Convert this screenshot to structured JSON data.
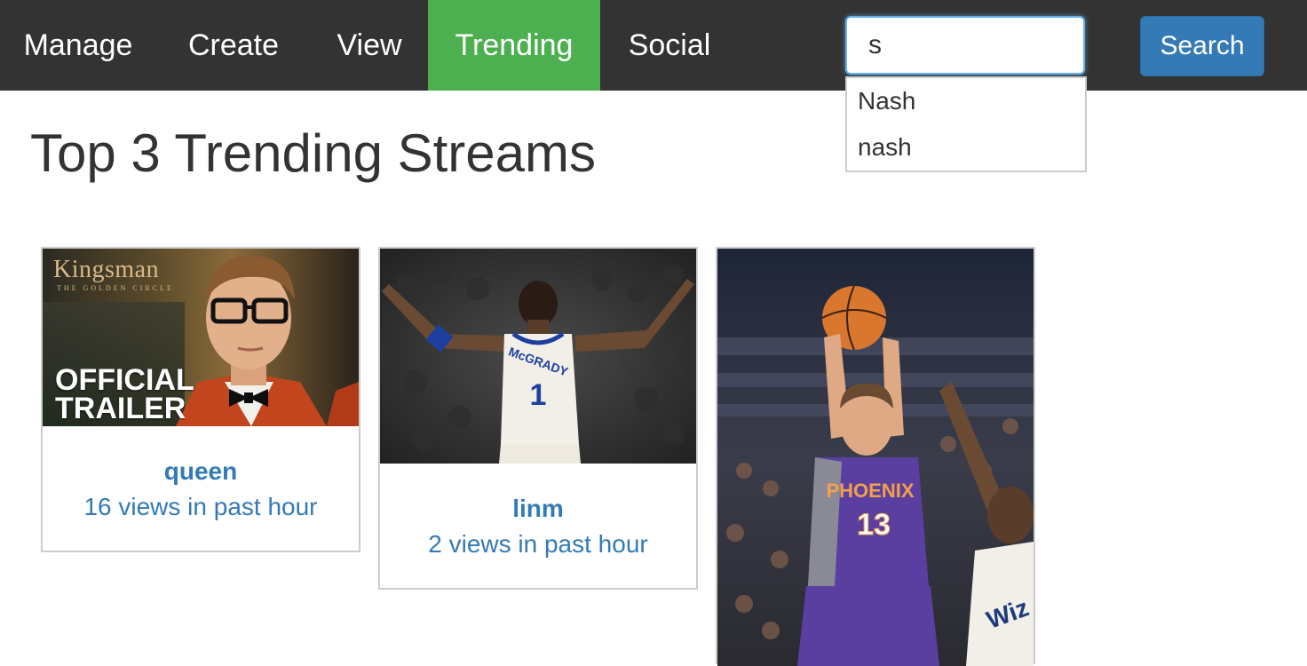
{
  "nav": {
    "items": [
      {
        "label": "Manage",
        "active": false
      },
      {
        "label": "Create",
        "active": false
      },
      {
        "label": "View",
        "active": false
      },
      {
        "label": "Trending",
        "active": true
      },
      {
        "label": "Social",
        "active": false
      }
    ],
    "active_color": "#4caf50",
    "background_color": "#333333"
  },
  "search": {
    "value": "s",
    "button_label": "Search",
    "button_color": "#337ab7",
    "suggestions": [
      "Nash",
      "nash"
    ]
  },
  "page": {
    "title": "Top 3 Trending Streams"
  },
  "streams": [
    {
      "name": "queen",
      "views": "16 views in past hour",
      "thumbnail": {
        "logo": "Kingsman",
        "logo_sub": "THE GOLDEN CIRCLE",
        "overlay_line1": "OFFICIAL",
        "overlay_line2": "TRAILER"
      }
    },
    {
      "name": "linm",
      "views": "2 views in past hour",
      "thumbnail": {
        "jersey_name": "McGRADY",
        "jersey_number": "1"
      }
    },
    {
      "thumbnail": {
        "jersey_name": "PHOENIX",
        "jersey_number": "13",
        "opponent_jersey": "Wiz"
      }
    }
  ],
  "link_color": "#337ab7"
}
